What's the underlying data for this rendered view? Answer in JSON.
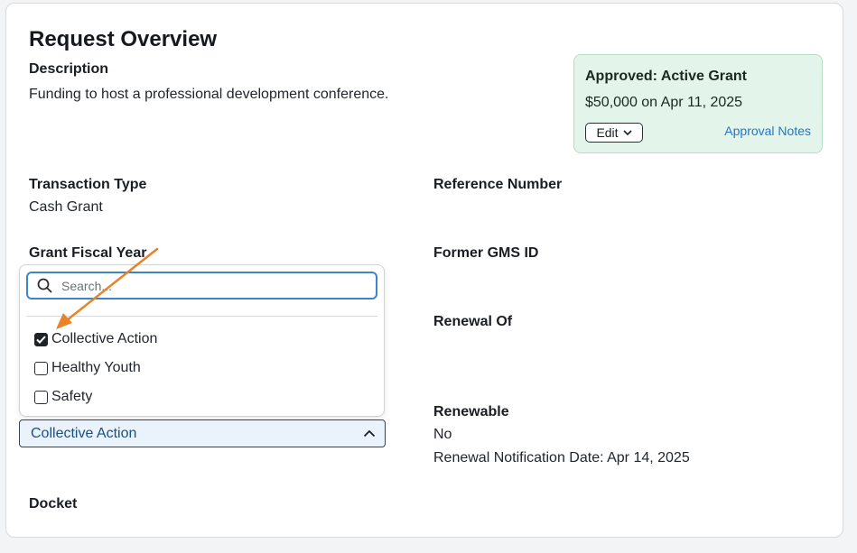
{
  "overview": {
    "title": "Request Overview",
    "description_label": "Description",
    "description_value": "Funding to host a professional development conference."
  },
  "approval": {
    "status": "Approved: Active Grant",
    "amount": "$50,000 on Apr 11, 2025",
    "edit_label": "Edit",
    "notes_link": "Approval Notes"
  },
  "fields": {
    "transaction_type_label": "Transaction Type",
    "transaction_type_value": "Cash Grant",
    "reference_number_label": "Reference Number",
    "grant_fiscal_year_label": "Grant Fiscal Year",
    "former_gms_label": "Former GMS ID",
    "renewal_of_label": "Renewal Of",
    "renewable_label": "Renewable",
    "renewable_value": "No",
    "renewal_notification": "Renewal Notification Date: Apr 14, 2025",
    "docket_label": "Docket"
  },
  "dropdown": {
    "search_placeholder": "Search...",
    "options": [
      {
        "label": "Collective Action",
        "checked": true
      },
      {
        "label": "Healthy Youth",
        "checked": false
      },
      {
        "label": "Safety",
        "checked": false
      }
    ],
    "selected_value": "Collective Action"
  },
  "colors": {
    "approved_bg": "#e3f5ea",
    "link": "#1f75cb",
    "search_focus": "#3a86c8",
    "select_bg": "#eaf3fc",
    "annotation_arrow": "#e8832a"
  }
}
